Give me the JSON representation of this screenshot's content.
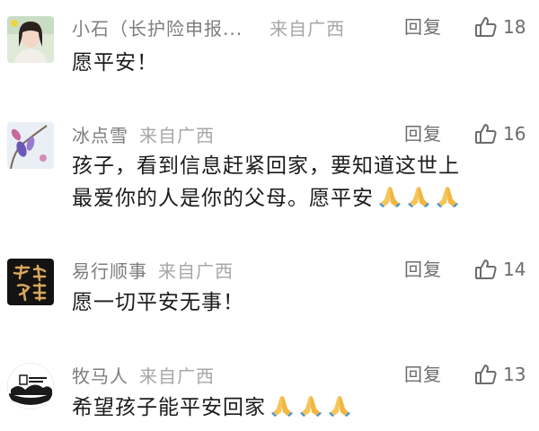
{
  "comments": [
    {
      "nickname": "小石（长护险申报...",
      "location": "",
      "reply_label": "回复",
      "likes": "18",
      "lines": [
        "愿平安！"
      ],
      "avatar_icon": "avatar-woman-portrait"
    },
    {
      "nickname": "冰点雪",
      "location": "来自广西",
      "reply_label": "回复",
      "likes": "16",
      "lines": [
        "孩子，看到信息赶紧回家，要知道这世上",
        "最爱你的人是你的父母。愿平安"
      ],
      "emoji": "folded-hands",
      "emoji_count": 3,
      "avatar_icon": "avatar-flower-painting"
    },
    {
      "nickname": "易行顺事",
      "location": "来自广西",
      "reply_label": "回复",
      "likes": "14",
      "lines": [
        "愿一切平安无事！"
      ],
      "avatar_icon": "avatar-calligraphy"
    },
    {
      "nickname": "牧马人",
      "location": "来自广西",
      "reply_label": "回复",
      "likes": "13",
      "lines": [
        "希望孩子能平安回家"
      ],
      "emoji": "folded-hands",
      "emoji_count": 3,
      "avatar_icon": "avatar-logo-black"
    }
  ],
  "header_location_1": "来自广西",
  "colors": {
    "nickname": "#7d7d7d",
    "location": "#a7a7a7",
    "text": "#1b1b1b",
    "action": "#6c6c6c"
  }
}
